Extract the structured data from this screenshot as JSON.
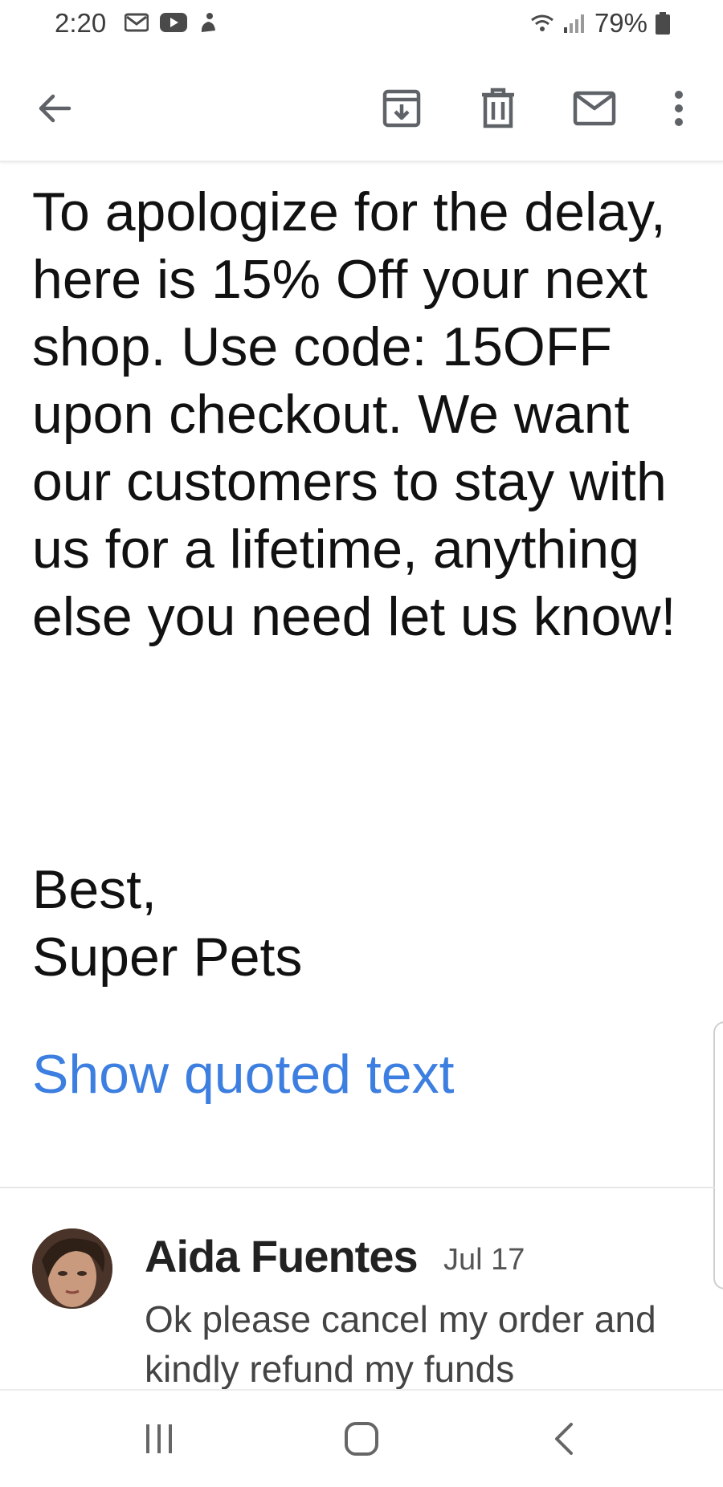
{
  "status_bar": {
    "time": "2:20",
    "battery": "79%",
    "left_icons": [
      "gmail-icon",
      "youtube-icon",
      "notification-icon"
    ],
    "right_icons": [
      "wifi-icon",
      "signal-icon",
      "battery-icon"
    ]
  },
  "toolbar": {
    "icons": [
      "back-arrow-icon",
      "archive-icon",
      "delete-icon",
      "mark-unread-icon",
      "more-vert-icon"
    ]
  },
  "message": {
    "body": "To apologize for the delay, here is 15% Off your next shop. Use code: 15OFF upon checkout. We want our customers to stay with us for a lifetime, anything else you need let us know!",
    "signoff_line1": "Best,",
    "signoff_line2": "Super Pets",
    "show_quoted": "Show quoted text"
  },
  "reply": {
    "sender": "Aida Fuentes",
    "date": "Jul 17",
    "snippet": "Ok please cancel my order and kindly refund my funds"
  },
  "colors": {
    "link": "#3d7fe0",
    "text": "#111111",
    "icon": "#5f6368"
  }
}
